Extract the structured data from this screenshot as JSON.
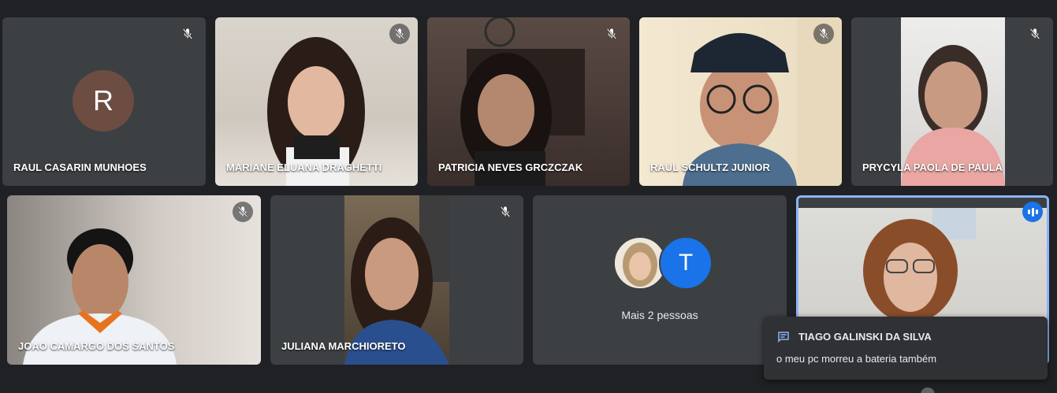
{
  "colors": {
    "background": "#202124",
    "tile": "#3c4043",
    "active_speaker": "#8ab4f8",
    "accent_blue": "#1a73e8",
    "avatar_r": "#6d4c41"
  },
  "participants_row1": [
    {
      "name": "RAUL CASARIN MUNHOES",
      "avatar_letter": "R",
      "muted": true
    },
    {
      "name": "MARIANE ELUANA DRAGHETTI",
      "muted": true
    },
    {
      "name": "PATRICIA NEVES GRCZCZAK",
      "muted": true
    },
    {
      "name": "RAUL SCHULTZ JUNIOR",
      "muted": true
    },
    {
      "name": "PRYCYLA PAOLA DE PAULA",
      "muted": true
    }
  ],
  "participants_row2": [
    {
      "name": "JOAO CAMARGO DOS SANTOS",
      "muted": true
    },
    {
      "name": "JULIANA MARCHIORETO",
      "muted": true
    }
  ],
  "more": {
    "label": "Mais 2 pessoas",
    "avatar_letter": "T"
  },
  "active_speaker_icon": "speaking-indicator-icon",
  "chat_toast": {
    "sender": "TIAGO GALINSKI DA SILVA",
    "message": "o meu pc morreu a bateria também",
    "icon": "chat-icon"
  }
}
